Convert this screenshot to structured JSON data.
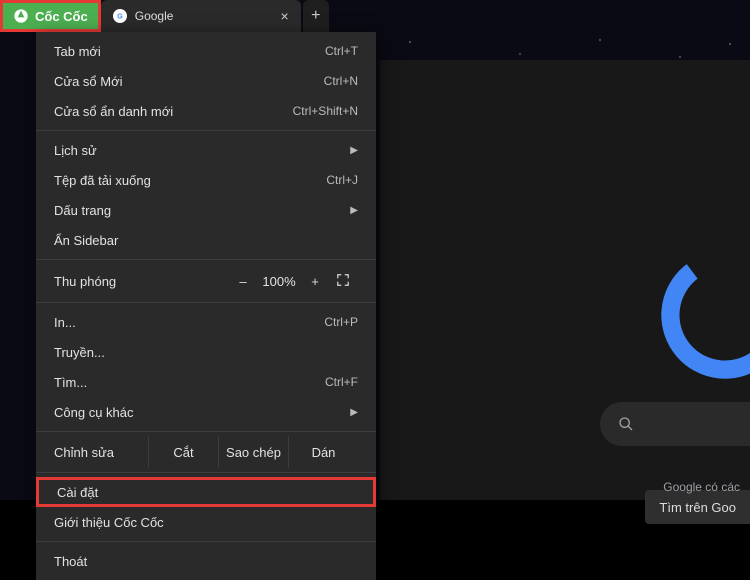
{
  "brand": {
    "name": "Cốc Cốc"
  },
  "tab": {
    "title": "Google",
    "favicon_letter": "G"
  },
  "menu": {
    "new_tab": {
      "label": "Tab mới",
      "shortcut": "Ctrl+T"
    },
    "new_window": {
      "label": "Cửa sổ Mới",
      "shortcut": "Ctrl+N"
    },
    "incognito": {
      "label": "Cửa sổ ẩn danh mới",
      "shortcut": "Ctrl+Shift+N"
    },
    "history": {
      "label": "Lịch sử"
    },
    "downloads": {
      "label": "Tệp đã tải xuống",
      "shortcut": "Ctrl+J"
    },
    "bookmarks": {
      "label": "Dấu trang"
    },
    "hide_sidebar": {
      "label": "Ẩn Sidebar"
    },
    "zoom": {
      "label": "Thu phóng",
      "minus": "–",
      "value": "100%",
      "plus": "+"
    },
    "print": {
      "label": "In...",
      "shortcut": "Ctrl+P"
    },
    "cast": {
      "label": "Truyền..."
    },
    "find": {
      "label": "Tìm...",
      "shortcut": "Ctrl+F"
    },
    "more_tools": {
      "label": "Công cụ khác"
    },
    "edit": {
      "label": "Chỉnh sửa",
      "cut": "Cắt",
      "copy": "Sao chép",
      "paste": "Dán"
    },
    "settings": {
      "label": "Cài đặt"
    },
    "about": {
      "label": "Giới thiệu Cốc Cốc"
    },
    "exit": {
      "label": "Thoát"
    }
  },
  "page": {
    "search_button": "Tìm trên Goo",
    "footer": "Google có các"
  },
  "colors": {
    "brand_green": "#4caf50",
    "highlight_red": "#e53935",
    "google_blue": "#4285f4"
  }
}
